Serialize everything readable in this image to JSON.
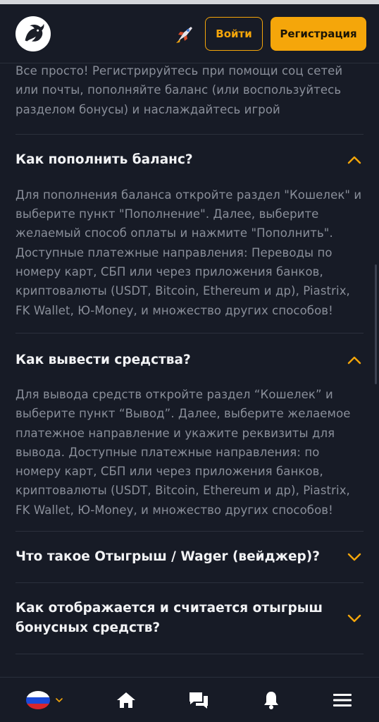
{
  "header": {
    "login_label": "Войти",
    "register_label": "Регистрация"
  },
  "faq": {
    "intro_answer": "Все просто! Регистрируйтесь при помощи соц сетей или почты, пополняйте баланс (или воспользуйтесь разделом бонусы) и наслаждайтесь игрой",
    "items": [
      {
        "question": "Как пополнить баланс?",
        "answer": "Для пополнения баланса откройте раздел \"Кошелек\" и выберите пункт \"Пополнение\". Далее, выберите желаемый способ оплаты и нажмите \"Пополнить\". Доступные платежные направления: Переводы по номеру карт, СБП или через приложения банков, криптовалюты (USDT, Bitcoin, Ethereum и др), Piastrix, FK Wallet, Ю-Money, и множество других способов!",
        "expanded": true
      },
      {
        "question": "Как вывести средства?",
        "answer": "Для вывода средств откройте раздел “Кошелек” и выберите пункт “Вывод”. Далее, выберите желаемое платежное направление и укажите реквизиты для вывода. Доступные платежные направления: по номеру карт, СБП или через приложения банков, криптовалюты (USDT, Bitcoin, Ethereum и др), Piastrix, FK Wallet, Ю-Money, и множество других способов!",
        "expanded": true
      },
      {
        "question": "Что такое Отыгрыш / Wager (вейджер)?",
        "expanded": false
      },
      {
        "question": "Как отображается и считается отыгрыш бонусных средств?",
        "expanded": false
      }
    ]
  },
  "bottom_nav": {
    "items": [
      "language-selector",
      "home",
      "chat",
      "notifications",
      "menu"
    ]
  },
  "colors": {
    "background": "#171b26",
    "accent": "#f5a60a",
    "answer_text": "#8a8f9a",
    "question_text": "#f2f3f5"
  }
}
